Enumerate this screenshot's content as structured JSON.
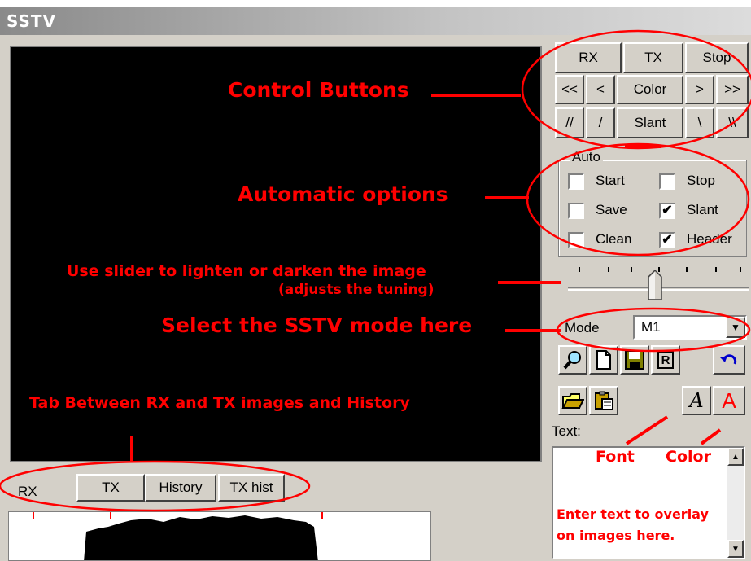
{
  "window": {
    "title": "SSTV"
  },
  "control_buttons": {
    "rx": "RX",
    "tx": "TX",
    "stop": "Stop",
    "rewind_fast": "<<",
    "rewind": "<",
    "color": "Color",
    "forward": ">",
    "forward_fast": ">>",
    "slant_left_fast": "//",
    "slant_left": "/",
    "slant": "Slant",
    "slant_right": "\\",
    "slant_right_fast": "\\\\"
  },
  "auto_group": {
    "title": "Auto",
    "options": [
      {
        "label": "Start",
        "checked": false
      },
      {
        "label": "Stop",
        "checked": false
      },
      {
        "label": "Save",
        "checked": false
      },
      {
        "label": "Slant",
        "checked": true
      },
      {
        "label": "Clean",
        "checked": false
      },
      {
        "label": "Header",
        "checked": true
      }
    ],
    "check_mark": "✔"
  },
  "slider": {
    "level": 0.5
  },
  "mode": {
    "label": "Mode",
    "value": "M1"
  },
  "toolbar_icons": [
    "zoom-icon",
    "new-icon",
    "save-icon",
    "r-icon",
    "undo-icon",
    "open-folder-icon",
    "paste-icon",
    "font-icon",
    "color-icon"
  ],
  "icon_text": {
    "r": "R",
    "font": "A",
    "color": "A"
  },
  "text_label": "Text:",
  "tabs": [
    "RX",
    "TX",
    "History",
    "TX hist"
  ],
  "annotations": {
    "control_buttons": "Control Buttons",
    "automatic_options": "Automatic options",
    "slider_line1": "Use slider to lighten or darken the image",
    "slider_line2": "(adjusts the tuning)",
    "mode": "Select the SSTV mode here",
    "tabs": "Tab Between RX and TX  images  and History",
    "font": "Font",
    "color": "Color",
    "text_line1": "Enter text to overlay",
    "text_line2": "on images here."
  },
  "colors": {
    "annotation": "#ff0000",
    "face": "#d4d0c8",
    "image_bg": "#000000"
  }
}
